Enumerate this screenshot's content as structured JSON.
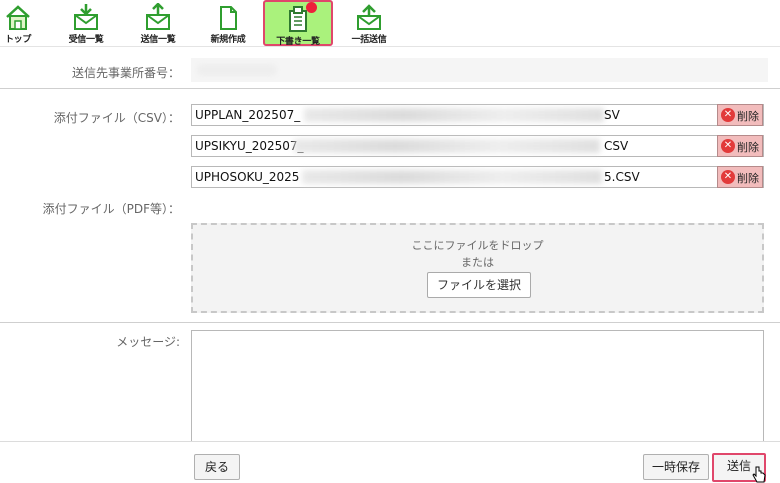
{
  "toolbar": {
    "items": [
      {
        "label": "トップ",
        "icon": "home-icon"
      },
      {
        "label": "受信一覧",
        "icon": "inbox-icon"
      },
      {
        "label": "送信一覧",
        "icon": "outbox-icon"
      },
      {
        "label": "新規作成",
        "icon": "new-document-icon"
      },
      {
        "label": "下書き一覧",
        "icon": "draft-icon"
      },
      {
        "label": "一括送信",
        "icon": "bulk-send-icon"
      }
    ],
    "active_color": "#aaf27c",
    "highlight_color": "#e0476b"
  },
  "form": {
    "destination_label": "送信先事業所番号：",
    "csv_label": "添付ファイル（CSV）：",
    "pdf_label": "添付ファイル（PDF等）：",
    "message_label": "メッセージ:",
    "csv_files": [
      {
        "prefix": "UPPLAN_202507_",
        "suffix": "SV",
        "delete_label": "削除"
      },
      {
        "prefix": "UPSIKYU_202507_",
        "suffix": "CSV",
        "delete_label": "削除"
      },
      {
        "prefix": "UPHOSOKU_2025",
        "suffix": "5.CSV",
        "delete_label": "削除"
      }
    ],
    "dropzone": {
      "line1": "ここにファイルをドロップ",
      "line2": "または",
      "choose_button": "ファイルを選択"
    }
  },
  "footer": {
    "back_button": "戻る",
    "save_button": "一時保存",
    "send_button": "送信"
  }
}
